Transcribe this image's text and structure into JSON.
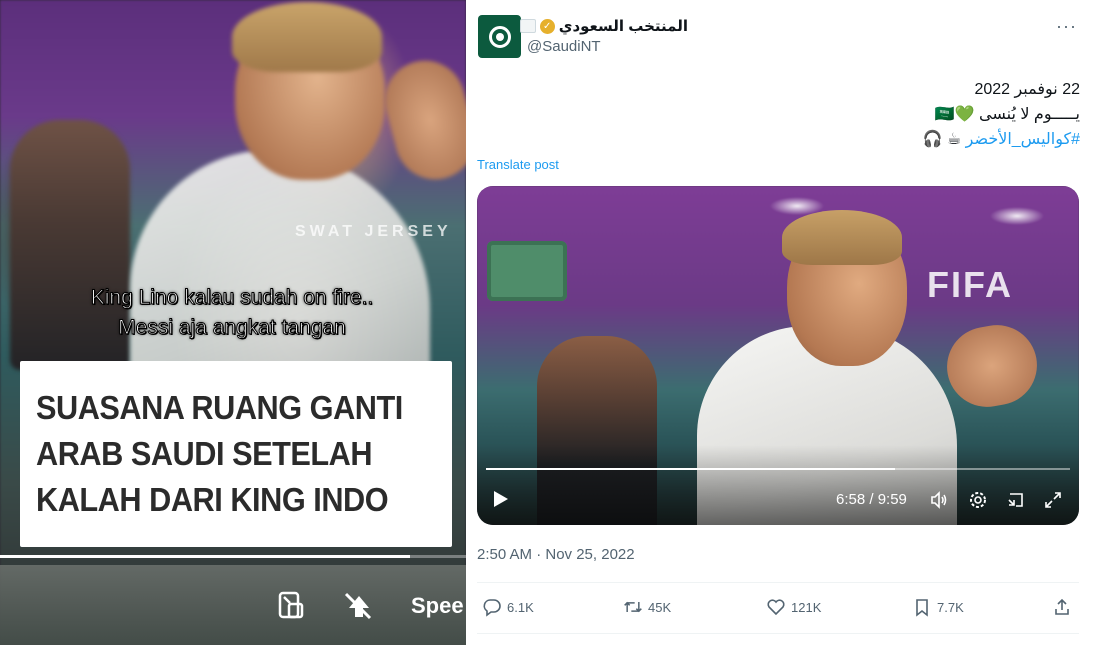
{
  "left_video": {
    "watermark": "SWAT JERSEY",
    "caption_line1": "King Lino kalau sudah on fire..",
    "caption_line2": "Messi aja angkat tangan",
    "title_lines": [
      "SUASANA RUANG GANTI",
      "ARAB SAUDI SETELAH",
      "KALAH DARI KING INDO"
    ],
    "progress_fraction": 0.88,
    "speed_label": "Spee",
    "icons": [
      "picture-in-picture-icon",
      "no-ads-icon"
    ]
  },
  "tweet": {
    "display_name": "المنتخب السعودي",
    "handle": "@SaudiNT",
    "more_label": "···",
    "text_line1": "22 نوفمبر 2022",
    "text_line2": "يـــــوم لا يُنسى 💚🇸🇦",
    "hashtag": "#كواليس_الأخضر",
    "text_line3_suffix": " ☕ 🎧",
    "translate_label": "Translate post",
    "timestamp": "2:50 AM · Nov 25, 2022",
    "colors": {
      "link": "#1d9bf0",
      "muted": "#536471",
      "verified": "#e6b02c",
      "avatar": "#0c5a3e"
    }
  },
  "tweet_video": {
    "wall_text": "FIFA",
    "time_label": "6:58 / 9:59",
    "progress_fraction": 0.7,
    "controls": [
      "play-icon",
      "volume-icon",
      "settings-icon",
      "picture-in-picture-icon",
      "fullscreen-icon"
    ]
  },
  "actions": {
    "replies": "6.1K",
    "reposts": "45K",
    "likes": "121K",
    "bookmarks": "7.7K"
  }
}
